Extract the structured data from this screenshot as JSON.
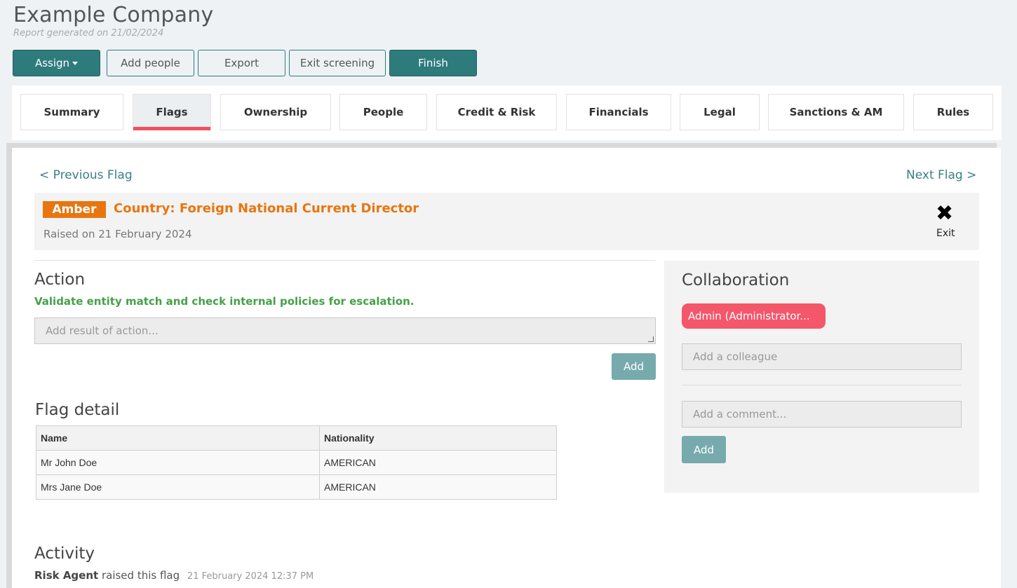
{
  "header": {
    "company": "Example Company",
    "generated": "Report generated on 21/02/2024"
  },
  "toolbar": {
    "assign": "Assign",
    "add_people": "Add people",
    "export": "Export",
    "exit_screening": "Exit screening",
    "finish": "Finish"
  },
  "tabs": [
    {
      "label": "Summary"
    },
    {
      "label": "Flags",
      "active": true
    },
    {
      "label": "Ownership"
    },
    {
      "label": "People"
    },
    {
      "label": "Credit & Risk"
    },
    {
      "label": "Financials"
    },
    {
      "label": "Legal"
    },
    {
      "label": "Sanctions & AM"
    },
    {
      "label": "Rules"
    }
  ],
  "flag_nav": {
    "previous": "< Previous Flag",
    "next": "Next Flag >"
  },
  "flag": {
    "level": "Amber",
    "level_color": "#e8760f",
    "title": "Country: Foreign National Current Director",
    "raised": "Raised on 21 February 2024",
    "exit_icon": "close-icon",
    "exit_label": "Exit"
  },
  "action": {
    "heading": "Action",
    "instruction": "Validate entity match and check internal policies for escalation.",
    "placeholder": "Add result of action...",
    "add_label": "Add"
  },
  "flag_detail": {
    "heading": "Flag detail",
    "columns": [
      "Name",
      "Nationality"
    ],
    "rows": [
      [
        "Mr John Doe",
        "AMERICAN"
      ],
      [
        "Mrs Jane Doe",
        "AMERICAN"
      ]
    ]
  },
  "collaboration": {
    "heading": "Collaboration",
    "assignee": "Admin (Administrator...",
    "colleague_placeholder": "Add a colleague",
    "comment_placeholder": "Add a comment...",
    "add_label": "Add"
  },
  "activity": {
    "heading": "Activity",
    "actor": "Risk Agent",
    "text": "raised this flag",
    "time": "21 February 2024 12:37 PM"
  }
}
